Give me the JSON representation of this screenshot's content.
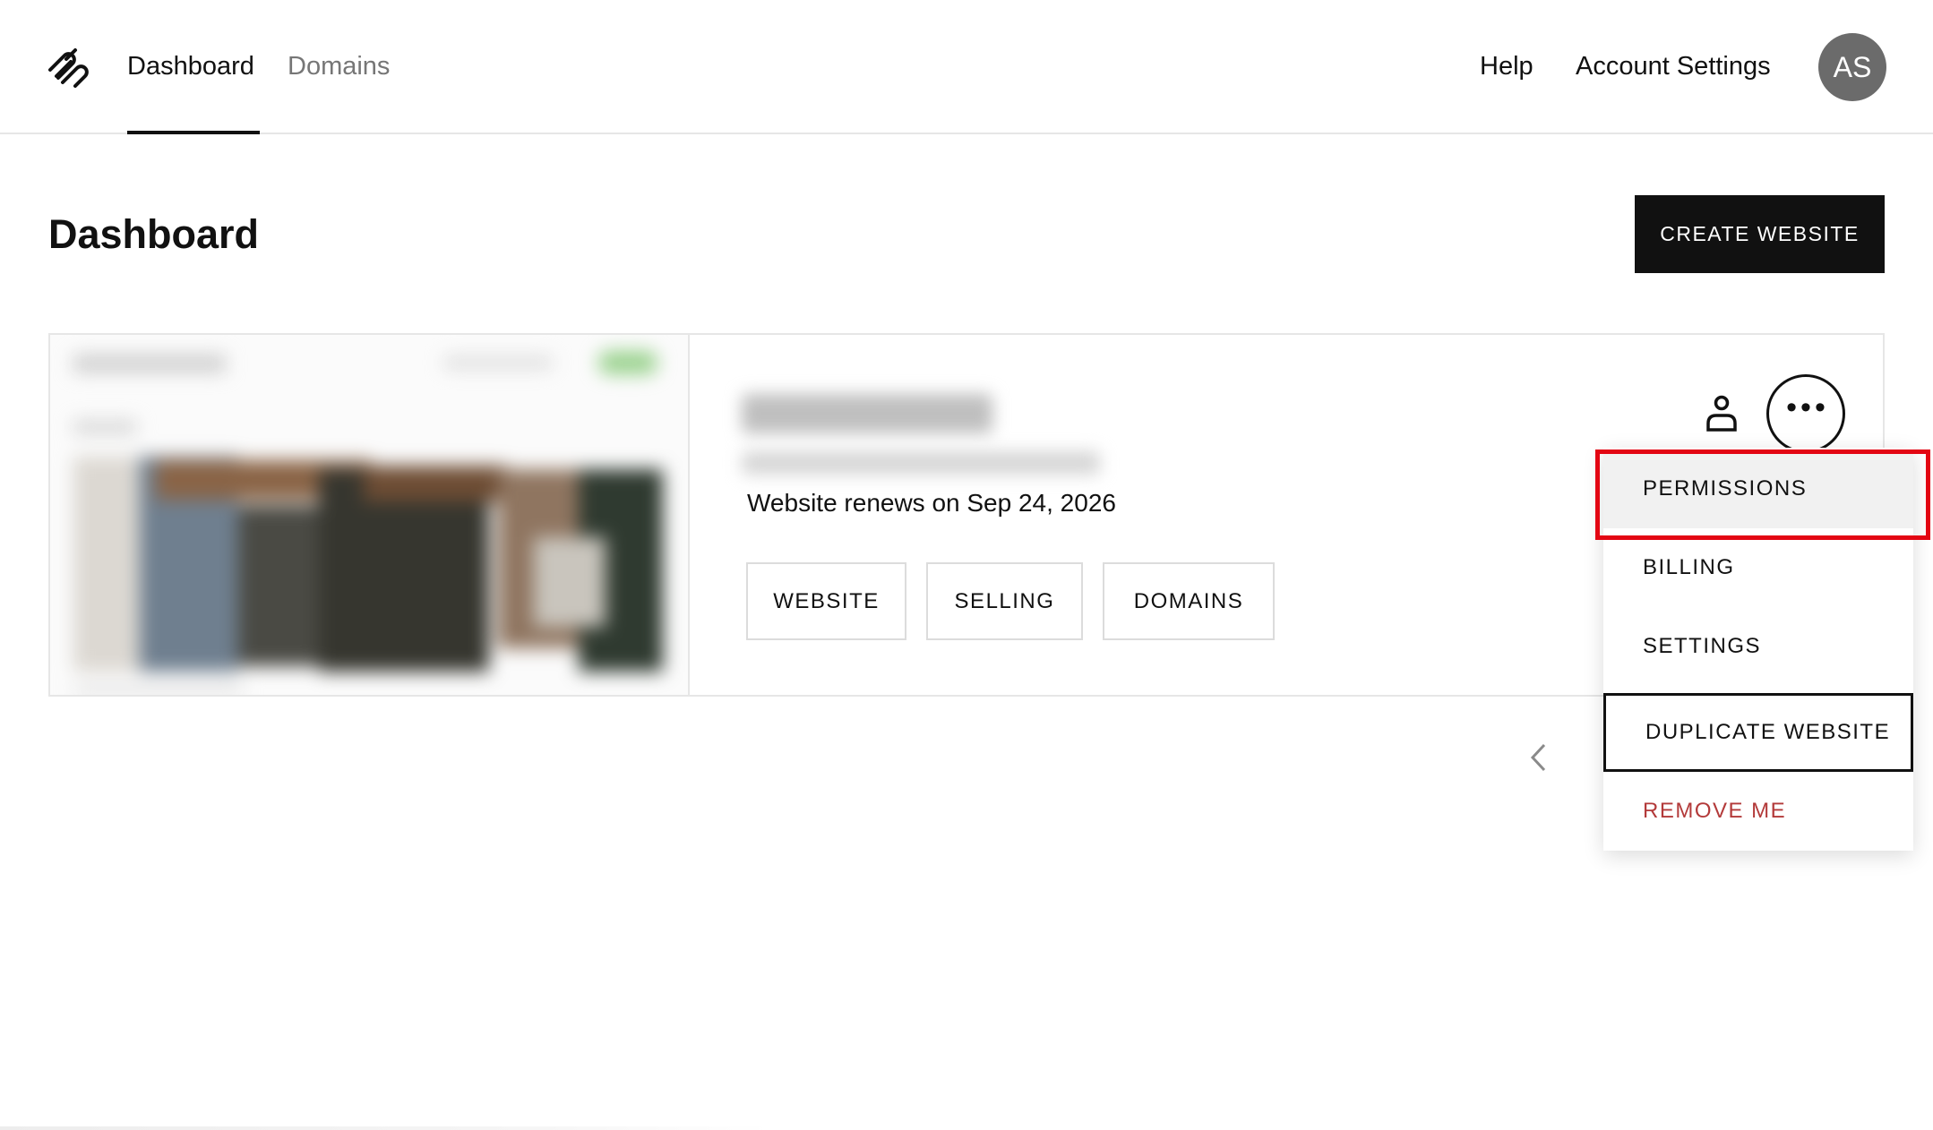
{
  "nav": {
    "links": [
      {
        "label": "Dashboard",
        "active": true
      },
      {
        "label": "Domains",
        "active": false
      }
    ],
    "help_label": "Help",
    "account_settings_label": "Account Settings",
    "avatar_initials": "AS",
    "logo_icon": "squarespace-logo-icon"
  },
  "page": {
    "title": "Dashboard",
    "create_button": "CREATE WEBSITE"
  },
  "site_card": {
    "name_blurred": true,
    "url_blurred": true,
    "renewal_text": "Website renews on Sep 24, 2026",
    "buttons": [
      "WEBSITE",
      "SELLING",
      "DOMAINS"
    ],
    "permissions_icon": "person-icon",
    "more_icon": "more-horizontal-icon"
  },
  "pager": {
    "prev_icon": "chevron-left-icon"
  },
  "dropdown": {
    "items": [
      {
        "label": "PERMISSIONS",
        "state": "hover"
      },
      {
        "label": "BILLING",
        "state": "default"
      },
      {
        "label": "SETTINGS",
        "state": "default"
      },
      {
        "label": "DUPLICATE WEBSITE",
        "state": "focused"
      },
      {
        "label": "REMOVE ME",
        "state": "danger"
      }
    ]
  },
  "annotation": {
    "highlight_target": "PERMISSIONS",
    "highlight_color": "#e30613"
  },
  "colors": {
    "primary": "#111111",
    "muted_text": "#767676",
    "border": "#e6e6e6",
    "danger": "#b33a3a",
    "avatar_bg": "#6b6b6b"
  }
}
